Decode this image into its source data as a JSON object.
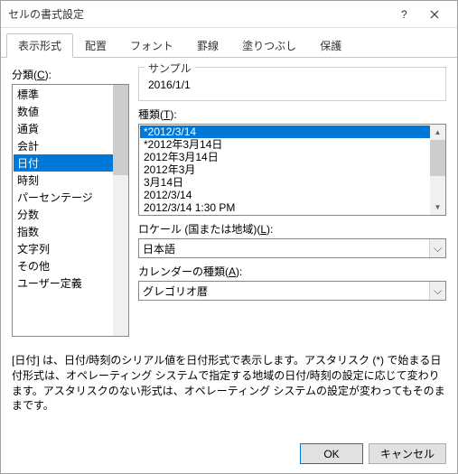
{
  "window": {
    "title": "セルの書式設定"
  },
  "tabs": [
    {
      "label": "表示形式"
    },
    {
      "label": "配置"
    },
    {
      "label": "フォント"
    },
    {
      "label": "罫線"
    },
    {
      "label": "塗りつぶし"
    },
    {
      "label": "保護"
    }
  ],
  "category": {
    "label_full": "分類(C):",
    "items": [
      "標準",
      "数値",
      "通貨",
      "会計",
      "日付",
      "時刻",
      "パーセンテージ",
      "分数",
      "指数",
      "文字列",
      "その他",
      "ユーザー定義"
    ],
    "selected_index": 4
  },
  "sample": {
    "legend": "サンプル",
    "value": "2016/1/1"
  },
  "type": {
    "label_full": "種類(T):",
    "items": [
      "*2012/3/14",
      "*2012年3月14日",
      "2012年3月14日",
      "2012年3月",
      "3月14日",
      "2012/3/14",
      "2012/3/14 1:30 PM"
    ],
    "selected_index": 0
  },
  "locale": {
    "label_full": "ロケール (国または地域)(L):",
    "value": "日本語"
  },
  "calendar": {
    "label_full": "カレンダーの種類(A):",
    "value": "グレゴリオ暦"
  },
  "description": "[日付] は、日付/時刻のシリアル値を日付形式で表示します。アスタリスク (*) で始まる日付形式は、オペレーティング システムで指定する地域の日付/時刻の設定に応じて変わります。アスタリスクのない形式は、オペレーティング システムの設定が変わってもそのままです。",
  "buttons": {
    "ok": "OK",
    "cancel": "キャンセル"
  }
}
